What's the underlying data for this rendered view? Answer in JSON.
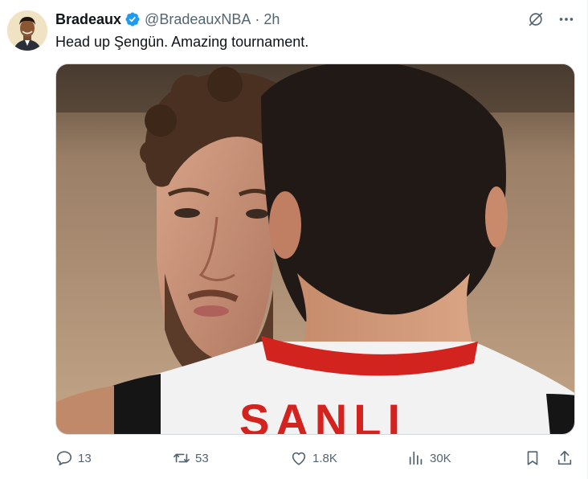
{
  "tweet": {
    "display_name": "Bradeaux",
    "handle": "@BradeauxNBA",
    "separator": "·",
    "time": "2h",
    "text": "Head up Şengün. Amazing tournament.",
    "verified": true
  },
  "media": {
    "jersey_text": "SANLI"
  },
  "actions": {
    "replies": "13",
    "reposts": "53",
    "likes": "1.8K",
    "views": "30K"
  },
  "icons": {
    "top": [
      "grok-icon",
      "more-icon"
    ],
    "bottom": [
      "reply-icon",
      "repost-icon",
      "like-icon",
      "views-icon",
      "bookmark-icon",
      "share-icon"
    ]
  },
  "colors": {
    "text": "#0f1419",
    "secondary": "#536471",
    "verified": "#1d9bf0",
    "jersey_red": "#d2231e"
  }
}
